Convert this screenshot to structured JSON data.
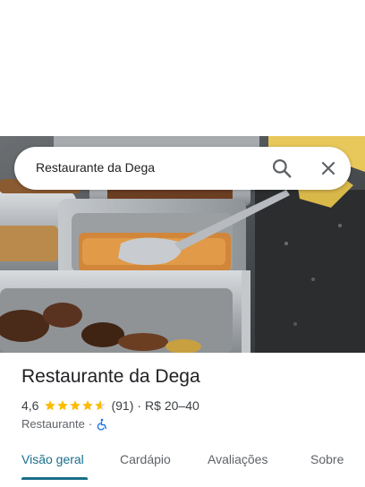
{
  "search": {
    "query": "Restaurante da Dega"
  },
  "place": {
    "name": "Restaurante da Dega",
    "rating": "4,6",
    "stars": 4.6,
    "review_count": "(91)",
    "separator": "·",
    "price": "R$ 20–40",
    "category": "Restaurante",
    "category_separator": "·",
    "accessibility_icon": "wheelchair-icon"
  },
  "tabs": [
    {
      "label": "Visão geral",
      "active": true
    },
    {
      "label": "Cardápio",
      "active": false
    },
    {
      "label": "Avaliações",
      "active": false
    },
    {
      "label": "Sobre",
      "active": false
    }
  ],
  "colors": {
    "accent": "#1a6f8a",
    "star": "#fbbc04",
    "accessibility": "#1a73e8"
  }
}
